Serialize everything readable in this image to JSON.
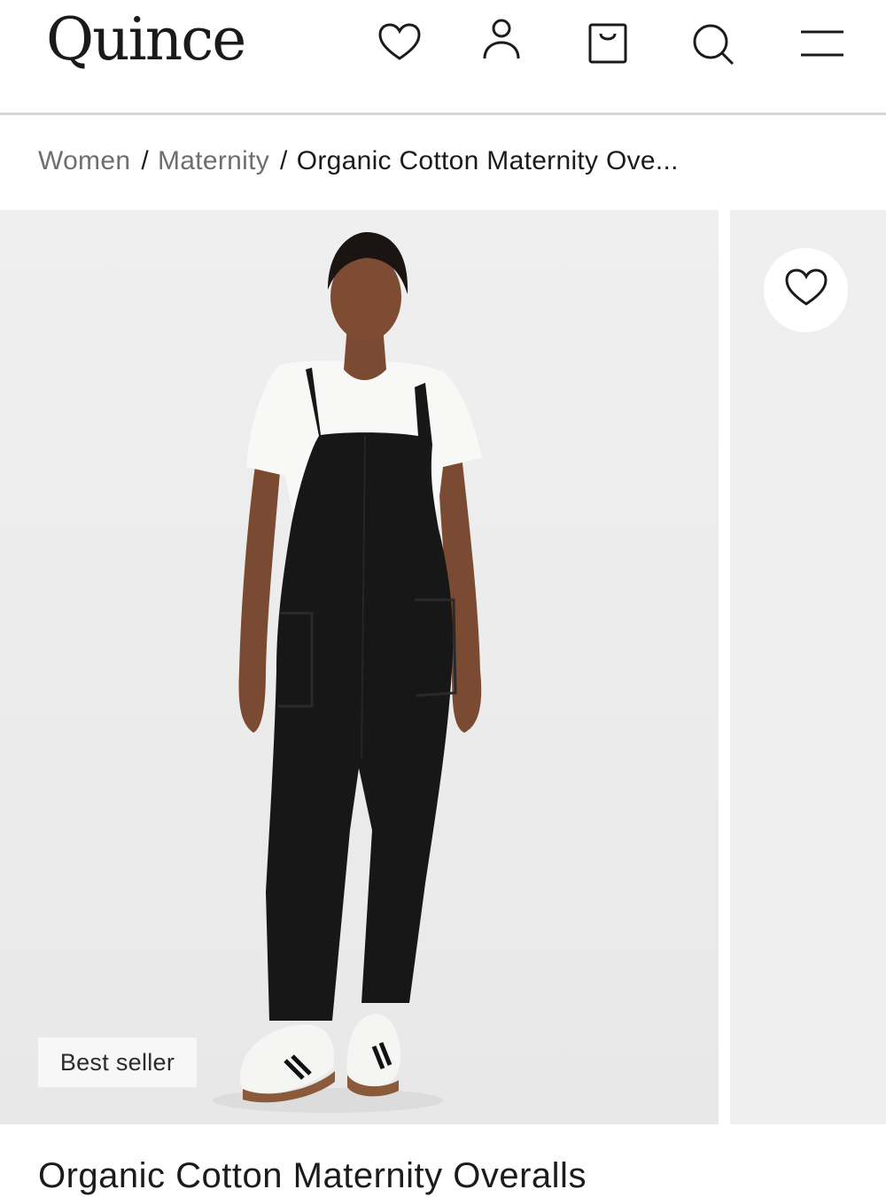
{
  "header": {
    "logo": "Quince",
    "icons": [
      "heart-icon",
      "user-icon",
      "shopping-bag-icon",
      "search-icon",
      "menu-icon"
    ]
  },
  "breadcrumb": {
    "items": [
      "Women",
      "Maternity"
    ],
    "separator": "/",
    "current": "Organic Cotton Maternity Ove..."
  },
  "gallery": {
    "badge": "Best seller",
    "wishlist_icon": "heart-icon"
  },
  "product": {
    "title": "Organic Cotton Maternity Overalls"
  },
  "colors": {
    "text": "#1b1b1b",
    "muted": "#6e6e6e",
    "image_bg": "#efefef",
    "divider": "#d6d6d6"
  }
}
